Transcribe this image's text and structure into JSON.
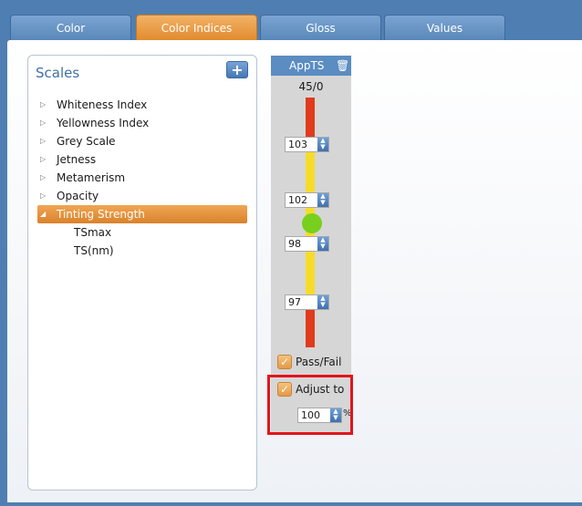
{
  "tabs": [
    {
      "label": "Color"
    },
    {
      "label": "Color Indices"
    },
    {
      "label": "Gloss"
    },
    {
      "label": "Values"
    }
  ],
  "scales": {
    "title": "Scales",
    "add_label": "+",
    "items": [
      {
        "label": "Whiteness Index"
      },
      {
        "label": "Yellowness Index"
      },
      {
        "label": "Grey Scale"
      },
      {
        "label": "Jetness"
      },
      {
        "label": "Metamerism"
      },
      {
        "label": "Opacity"
      },
      {
        "label": "Tinting Strength"
      }
    ],
    "children": [
      {
        "label": "TSmax"
      },
      {
        "label": "TS(nm)"
      }
    ]
  },
  "appts": {
    "title": "AppTS",
    "top_value": "45/0",
    "spinners": [
      "103",
      "102",
      "98",
      "97"
    ],
    "pass_fail_label": "Pass/Fail",
    "adjust_label": "Adjust to",
    "adjust_value": "100",
    "adjust_unit": "%"
  },
  "colors": {
    "accent": "#e28b2e",
    "header": "#4f7fb2",
    "red": "#e03b1d",
    "yellow": "#f5dc2a",
    "green": "#79cf1e",
    "highlight": "#e3141b"
  },
  "icons": {
    "collapsed": "triangle-right",
    "expanded": "triangle-down",
    "trash": "trash-icon",
    "check": "check-icon"
  }
}
